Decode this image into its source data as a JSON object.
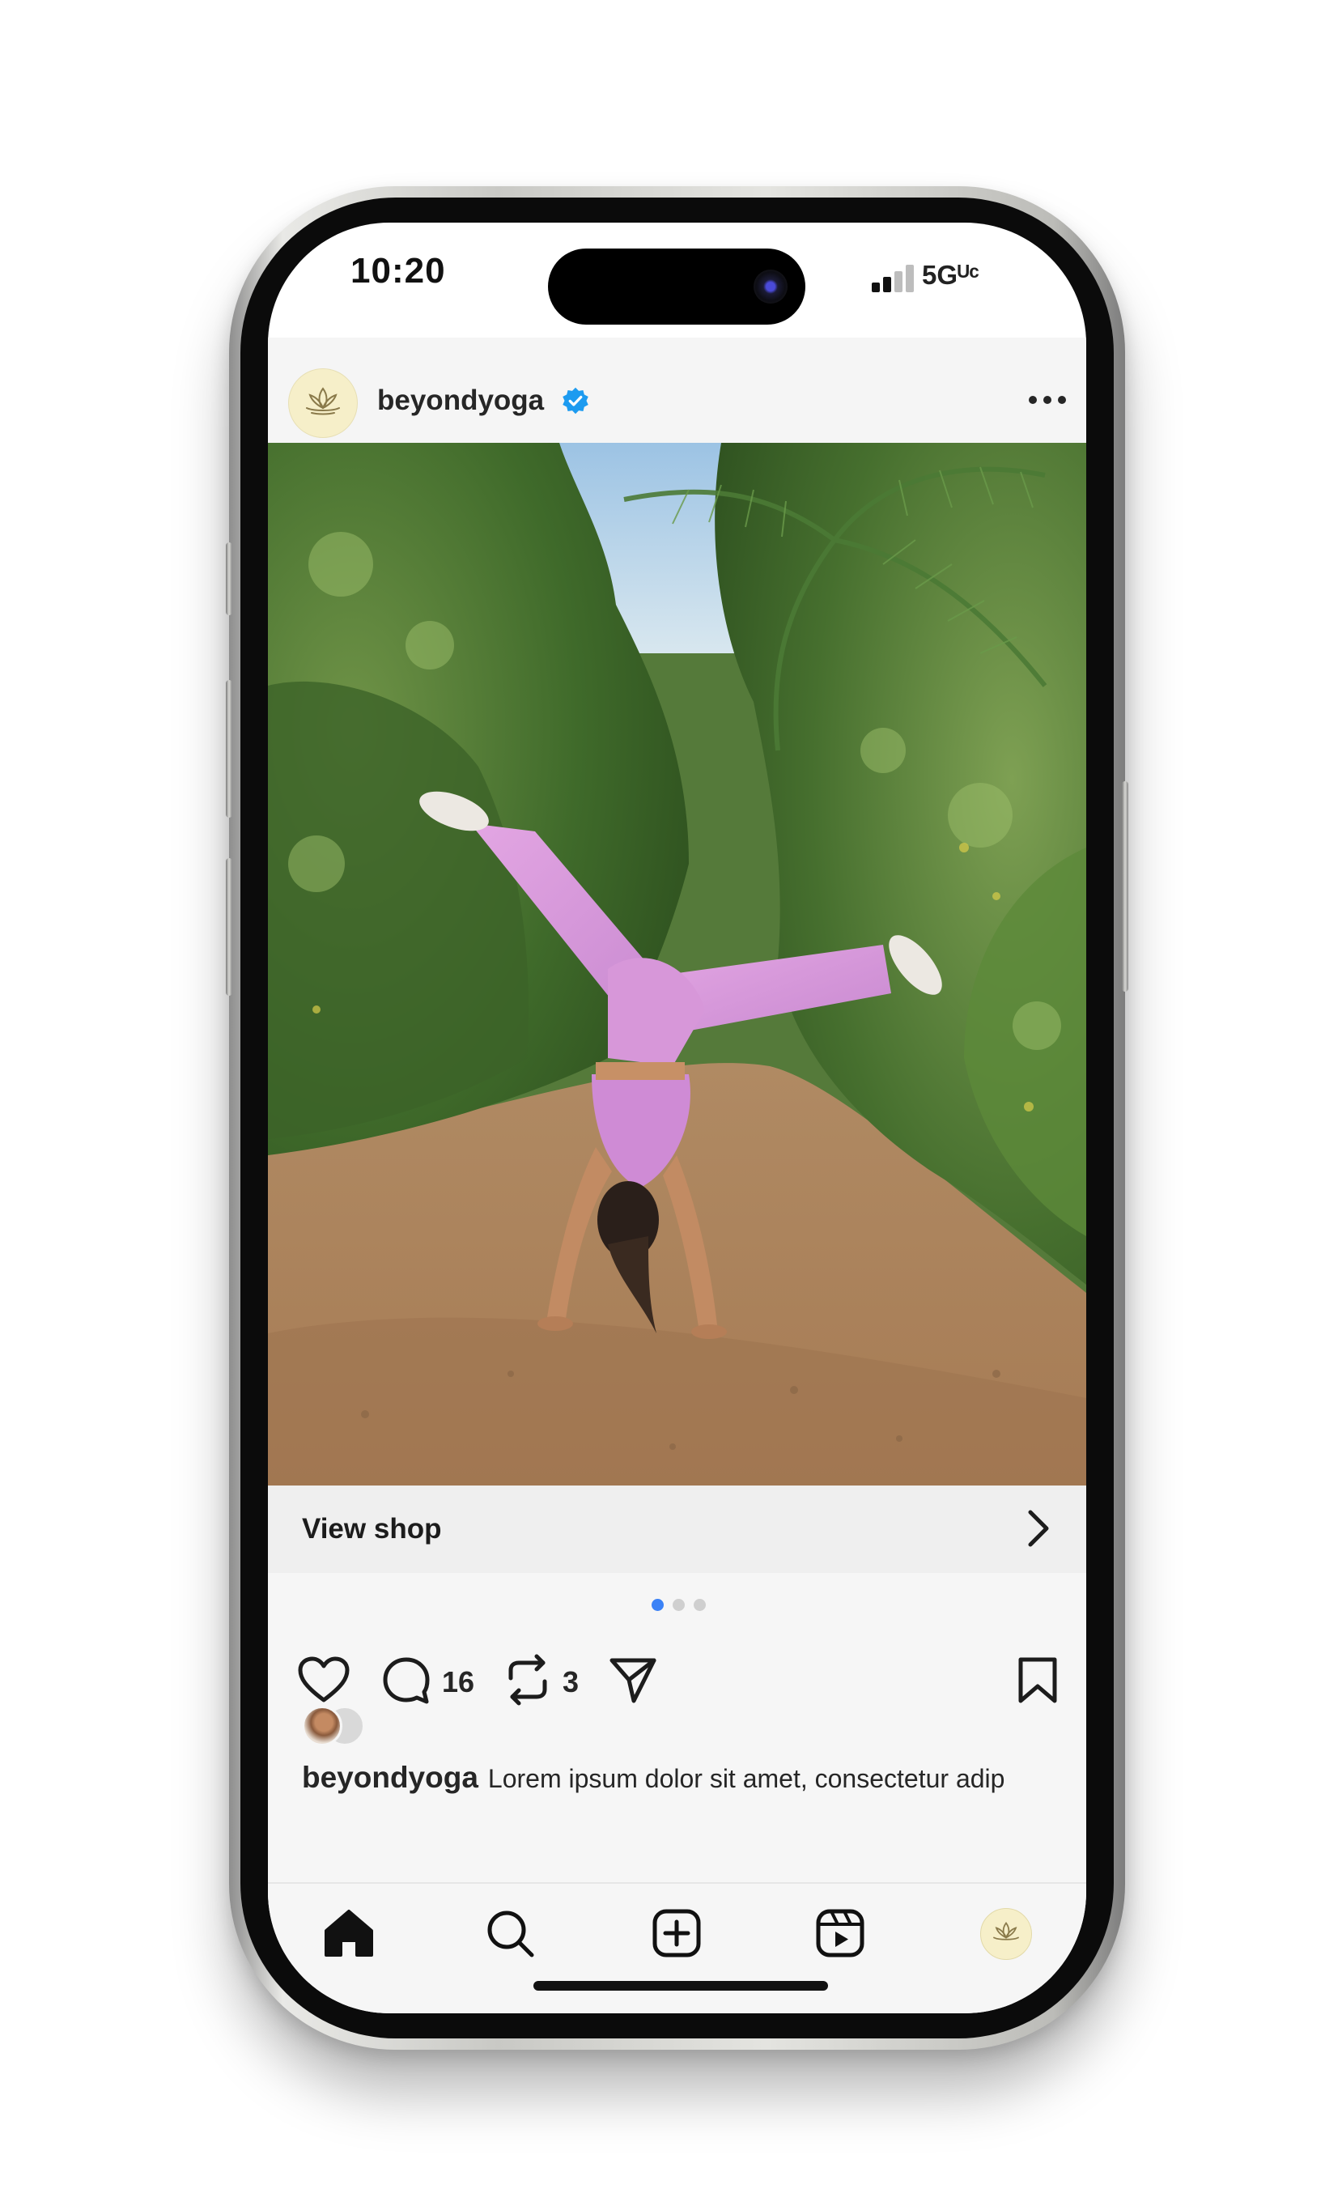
{
  "status_bar": {
    "time": "10:20",
    "network": "5Gᵁᶜ",
    "signal_icon": "cellular-signal-icon"
  },
  "post": {
    "username": "beyondyoga",
    "verified_icon": "verified-badge-icon",
    "more_icon": "more-horizontal-icon",
    "avatar_icon": "lotus-logo",
    "image_description_icon": "photo",
    "carousel": {
      "total": 3,
      "active_index": 0
    },
    "shop": {
      "label": "View shop",
      "icon": "chevron-right-icon"
    },
    "actions": {
      "like_icon": "heart-icon",
      "comment_icon": "comment-icon",
      "comment_count": "16",
      "repost_icon": "repost-icon",
      "repost_count": "3",
      "share_icon": "send-icon",
      "save_icon": "bookmark-icon"
    },
    "caption": {
      "user": "beyondyoga",
      "text": "Lorem ipsum dolor sit amet, consectetur adip"
    }
  },
  "tab_bar": {
    "items": [
      "home-icon",
      "search-icon",
      "create-icon",
      "reels-icon",
      "profile-avatar"
    ]
  },
  "colors": {
    "accent_blue": "#3b82f6",
    "verified_blue": "#1d9bf0",
    "text_dark": "#262626",
    "avatar_bg": "#f6efc9"
  }
}
